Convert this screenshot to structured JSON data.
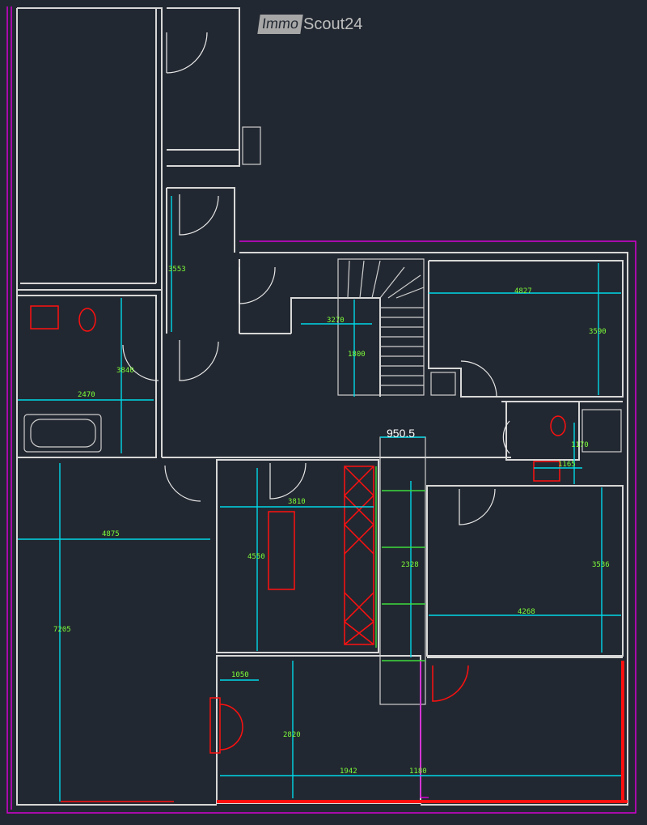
{
  "logo": {
    "part1": "Immo",
    "part2": "Scout24"
  },
  "colors": {
    "background": "#222831",
    "walls": "#d7d7d7",
    "dimensions": "#00d8e8",
    "dimension_text": "#7dff3a",
    "boundary": "#d400d4",
    "fixtures": "#ff1010"
  },
  "dimensions": {
    "main_label": "950.5",
    "d1": "4827",
    "d2": "3590",
    "d3": "3553",
    "d4": "3840",
    "d5": "2470",
    "d6": "3270",
    "d7": "1800",
    "d8": "1942",
    "d9": "1180",
    "d10": "4875",
    "d11": "7205",
    "d12": "3810",
    "d13": "4550",
    "d14": "2328",
    "d15": "3536",
    "d16": "4268",
    "d17": "1050",
    "d18": "2820",
    "d19": "1170",
    "d20": "1165"
  }
}
